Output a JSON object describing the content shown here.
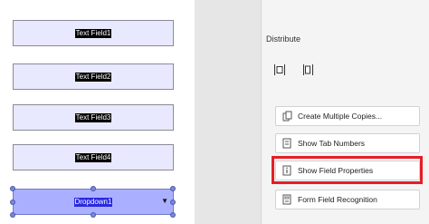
{
  "form_fields": {
    "fields": [
      {
        "label": "Text Field1"
      },
      {
        "label": "Text Field2"
      },
      {
        "label": "Text Field3"
      },
      {
        "label": "Text Field4"
      }
    ],
    "dropdown": {
      "label": "Dropdown1",
      "arrow": "▼"
    }
  },
  "right_panel": {
    "distribute": {
      "title": "Distribute",
      "icons": [
        "distribute-horizontal-icon",
        "distribute-vertical-icon"
      ]
    },
    "tools": [
      {
        "label": "Create Multiple Copies...",
        "icon": "copies-icon"
      },
      {
        "label": "Show Tab Numbers",
        "icon": "tab-numbers-icon"
      },
      {
        "label": "Show Field Properties",
        "icon": "field-properties-icon",
        "highlighted": true
      },
      {
        "label": "Form Field Recognition",
        "icon": "form-recognition-icon"
      }
    ]
  },
  "colors": {
    "highlight": "#e51e25",
    "field_fill": "#e8e8ff",
    "dropdown_fill": "#aab0ff",
    "dropdown_label_bg": "#2a2ae0"
  }
}
